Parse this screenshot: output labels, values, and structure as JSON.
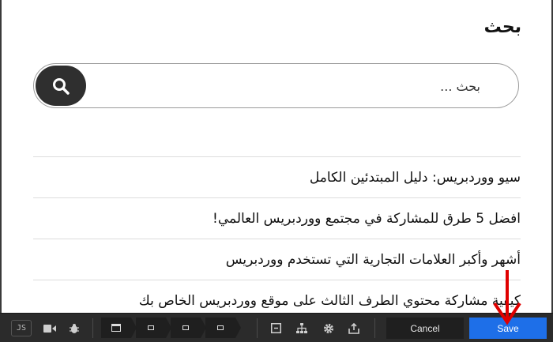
{
  "widget": {
    "title": "بحث"
  },
  "search": {
    "placeholder": "بحث ..."
  },
  "posts": [
    {
      "title": "سيو ووردبريس: دليل المبتدئين الكامل"
    },
    {
      "title": "افضل 5 طرق للمشاركة في مجتمع ووردبريس العالمي!"
    },
    {
      "title": "أشهر وأكبر العلامات التجارية التي تستخدم ووردبريس"
    },
    {
      "title": "كيفية مشاركة محتوي الطرف الثالث على موقع ووردبريس الخاص بك"
    }
  ],
  "toolbar": {
    "js_label": "JS",
    "cancel_label": "Cancel",
    "save_label": "Save",
    "icons": [
      "video-icon",
      "bug-icon",
      "window-icon",
      "module-icon",
      "row-icon",
      "element-icon",
      "text-field-icon",
      "sitemap-icon",
      "gear-icon",
      "export-icon"
    ]
  },
  "colors": {
    "save": "#1e6fe8",
    "search_button": "#2f2f2f",
    "toolbar_bg": "#2b2b2b",
    "annotation_arrow": "#e00000"
  }
}
